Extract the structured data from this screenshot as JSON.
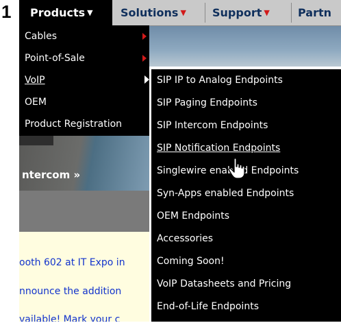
{
  "step_number": "1",
  "nav": {
    "products": "Products",
    "solutions": "Solutions",
    "support": "Support",
    "partners": "Partn"
  },
  "products_menu": {
    "items": [
      "Cables",
      "Point-of-Sale",
      "VoIP",
      "OEM",
      "Product Registration"
    ]
  },
  "voip_submenu": {
    "items": [
      "SIP IP to Analog Endpoints",
      "SIP Paging Endpoints",
      "SIP Intercom Endpoints",
      "SIP Notification Endpoints",
      "Singlewire enabled Endpoints",
      "Syn-Apps enabled Endpoints",
      "OEM Endpoints",
      "Accessories",
      "Coming Soon!",
      "VoIP Datasheets and Pricing",
      "End-of-Life Endpoints"
    ]
  },
  "page": {
    "hero_label": "ntercom »",
    "news_lines": [
      "ooth 602 at IT Expo in",
      "nnounce the addition",
      "vailable! Mark your c"
    ]
  },
  "colors": {
    "nav_text": "#0f2f5c",
    "caret_red": "#d21a1a",
    "menu_bg": "#000000",
    "link_blue": "#1233cc"
  }
}
